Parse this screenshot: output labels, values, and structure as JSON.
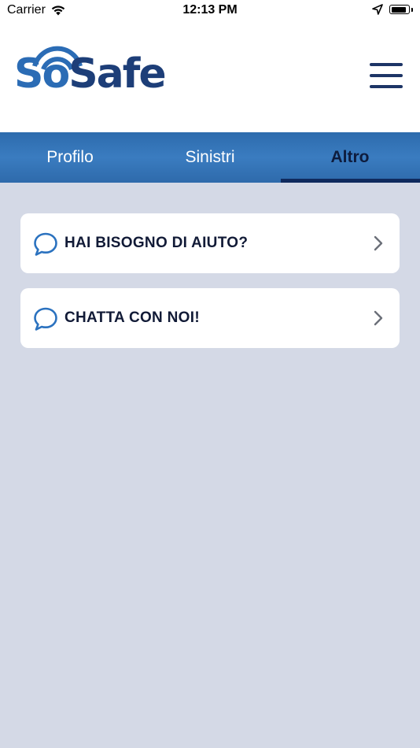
{
  "status_bar": {
    "carrier": "Carrier",
    "time": "12:13 PM",
    "battery_level": 0.9
  },
  "header": {
    "logo_part1": "So",
    "logo_part2": "Safe",
    "logo_color_primary": "#2b6cb5",
    "logo_color_secondary": "#1d3e78",
    "menu_icon": "hamburger-icon"
  },
  "tabs": [
    {
      "label": "Profilo",
      "active": false
    },
    {
      "label": "Sinistri",
      "active": false
    },
    {
      "label": "Altro",
      "active": true
    }
  ],
  "colors": {
    "tabbar": "#3a7cc0",
    "tab_indicator": "#0f2a5e",
    "background": "#d4d9e6",
    "accent_icon": "#2b72bf"
  },
  "menu_items": [
    {
      "label": "HAI BISOGNO DI AIUTO?",
      "icon": "chat-bubble-icon",
      "trailing_icon": "chevron-right-icon"
    },
    {
      "label": "CHATTA CON NOI!",
      "icon": "chat-bubble-icon",
      "trailing_icon": "chevron-right-icon"
    }
  ]
}
